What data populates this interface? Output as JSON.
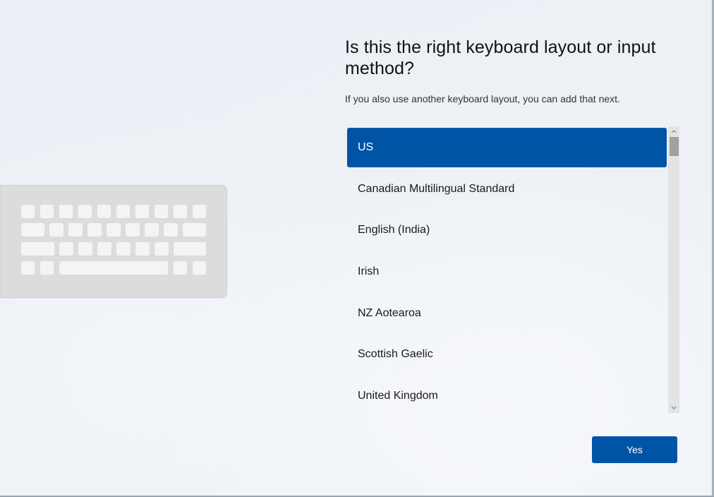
{
  "header": {
    "title": "Is this the right keyboard layout or input method?",
    "subtitle": "If you also use another keyboard layout, you can add that next."
  },
  "layouts": {
    "selected_index": 0,
    "items": [
      {
        "label": "US"
      },
      {
        "label": "Canadian Multilingual Standard"
      },
      {
        "label": "English (India)"
      },
      {
        "label": "Irish"
      },
      {
        "label": "NZ Aotearoa"
      },
      {
        "label": "Scottish Gaelic"
      },
      {
        "label": "United Kingdom"
      }
    ]
  },
  "actions": {
    "yes_label": "Yes"
  },
  "illustration": {
    "icon": "keyboard-icon"
  },
  "colors": {
    "accent": "#0054a6",
    "background": "#edf1f6",
    "keyboard_body": "#dcdcdc",
    "key_cap": "#f4f4f4",
    "scrollbar_track": "#e3e3e3",
    "scrollbar_thumb": "#a0a0a0"
  }
}
